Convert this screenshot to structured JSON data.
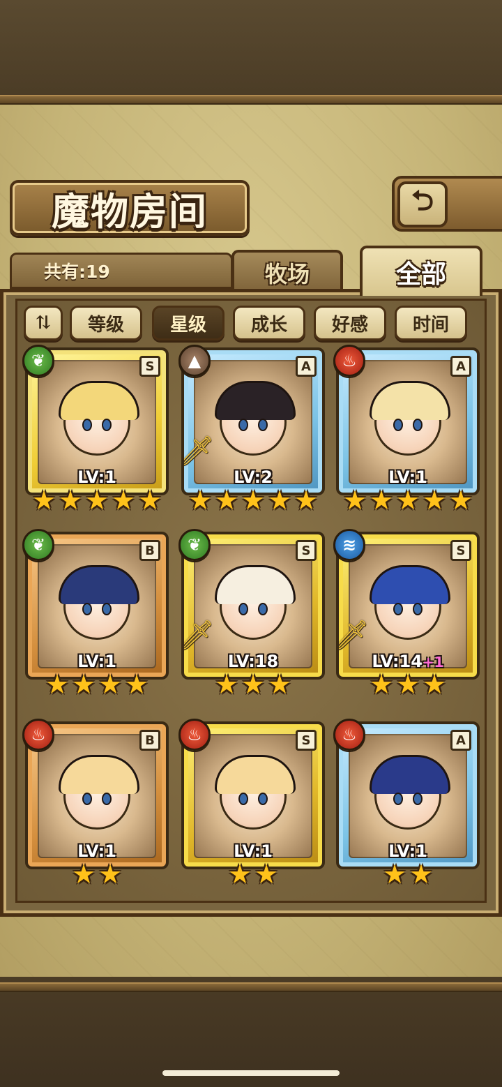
{
  "header": {
    "title": "魔物房间",
    "back_icon": "back-arrow-icon"
  },
  "count": {
    "label": "共有:19"
  },
  "tabs": [
    {
      "label": "牧场",
      "active": false
    },
    {
      "label": "全部",
      "active": true
    }
  ],
  "sort": {
    "toggle_icon": "sort-toggle-icon",
    "buttons": [
      {
        "label": "等级",
        "active": false
      },
      {
        "label": "星级",
        "active": true
      },
      {
        "label": "成长",
        "active": false
      },
      {
        "label": "好感",
        "active": false
      },
      {
        "label": "时间",
        "active": false
      }
    ]
  },
  "monsters": [
    {
      "rank": "S",
      "element": "nature",
      "level": "LV:1",
      "bonus": "",
      "stars": 5,
      "frame": "gold",
      "weapon": false,
      "hair": "#f3d77a"
    },
    {
      "rank": "A",
      "element": "earth",
      "level": "LV:2",
      "bonus": "",
      "stars": 5,
      "frame": "a",
      "weapon": true,
      "hair": "#2a2226"
    },
    {
      "rank": "A",
      "element": "fire",
      "level": "LV:1",
      "bonus": "",
      "stars": 5,
      "frame": "a",
      "weapon": false,
      "hair": "#f4e2a8"
    },
    {
      "rank": "B",
      "element": "nature",
      "level": "LV:1",
      "bonus": "",
      "stars": 4,
      "frame": "b",
      "weapon": false,
      "hair": "#2a3a7a"
    },
    {
      "rank": "S",
      "element": "nature",
      "level": "LV:18",
      "bonus": "",
      "stars": 3,
      "frame": "s",
      "weapon": true,
      "hair": "#f6efe0"
    },
    {
      "rank": "S",
      "element": "water",
      "level": "LV:14",
      "bonus": "+1",
      "stars": 3,
      "frame": "s",
      "weapon": true,
      "hair": "#2e4eb0"
    },
    {
      "rank": "B",
      "element": "fire",
      "level": "LV:1",
      "bonus": "",
      "stars": 2,
      "frame": "b",
      "weapon": false,
      "hair": "#f6d99a"
    },
    {
      "rank": "S",
      "element": "fire",
      "level": "LV:1",
      "bonus": "",
      "stars": 2,
      "frame": "s",
      "weapon": false,
      "hair": "#f6d99a"
    },
    {
      "rank": "A",
      "element": "fire",
      "level": "LV:1",
      "bonus": "",
      "stars": 2,
      "frame": "a",
      "weapon": false,
      "hair": "#2a3a8a"
    }
  ],
  "element_glyphs": {
    "nature": "❦",
    "fire": "♨",
    "earth": "▲",
    "water": "≋"
  },
  "star_glyph": "★",
  "sword_glyph": "🗡"
}
